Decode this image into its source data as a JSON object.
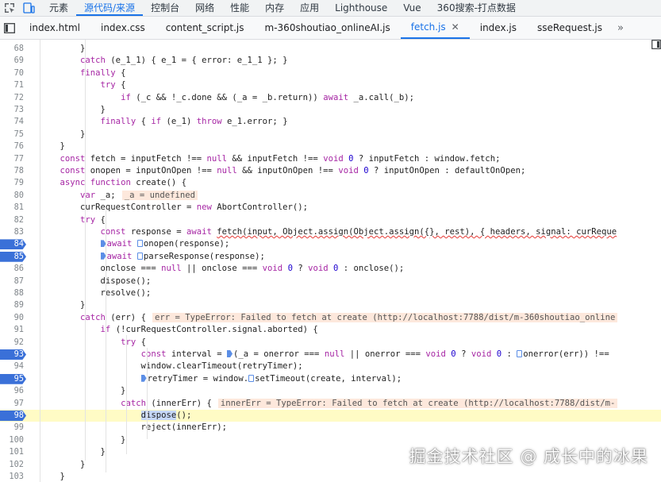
{
  "panel_tabs": [
    "元素",
    "源代码/来源",
    "控制台",
    "网络",
    "性能",
    "内存",
    "应用",
    "Lighthouse",
    "Vue",
    "360搜索-打点数据"
  ],
  "active_panel": 1,
  "file_tabs": [
    "index.html",
    "index.css",
    "content_script.js",
    "m-360shoutiao_onlineAI.js",
    "fetch.js",
    "index.js",
    "sseRequest.js"
  ],
  "active_file": 4,
  "more_tabs": "»",
  "lines": [
    {
      "n": "68",
      "code": "        }"
    },
    {
      "n": "69",
      "code": "        catch (e_1_1) { e_1 = { error: e_1_1 }; }"
    },
    {
      "n": "70",
      "code": "        finally {"
    },
    {
      "n": "71",
      "code": "            try {"
    },
    {
      "n": "72",
      "code": "                if (_c && !_c.done && (_a = _b.return)) await _a.call(_b);"
    },
    {
      "n": "73",
      "code": "            }"
    },
    {
      "n": "74",
      "code": "            finally { if (e_1) throw e_1.error; }"
    },
    {
      "n": "75",
      "code": "        }"
    },
    {
      "n": "76",
      "code": "    }"
    },
    {
      "n": "77",
      "code": "    const fetch = inputFetch !== null && inputFetch !== void 0 ? inputFetch : window.fetch;"
    },
    {
      "n": "78",
      "code": "    const onopen = inputOnOpen !== null && inputOnOpen !== void 0 ? inputOnOpen : defaultOnOpen;"
    },
    {
      "n": "79",
      "code": "    async function create() {"
    },
    {
      "n": "80",
      "code": "        var _a;",
      "inline": "_a = undefined"
    },
    {
      "n": "81",
      "code": "        curRequestController = new AbortController();"
    },
    {
      "n": "82",
      "code": "        try {"
    },
    {
      "n": "83",
      "code": "            const response = await fetch(input, Object.assign(Object.assign({}, rest), { headers, signal: curReque"
    },
    {
      "n": "84",
      "code": "            await onopen(response);",
      "bp": true
    },
    {
      "n": "85",
      "code": "            await parseResponse(response);",
      "bp": true
    },
    {
      "n": "86",
      "code": "            onclose === null || onclose === void 0 ? void 0 : onclose();"
    },
    {
      "n": "87",
      "code": "            dispose();"
    },
    {
      "n": "88",
      "code": "            resolve();"
    },
    {
      "n": "89",
      "code": "        }"
    },
    {
      "n": "90",
      "code": "        catch (err) {",
      "inline": "err = TypeError: Failed to fetch at create (http://localhost:7788/dist/m-360shoutiao_online"
    },
    {
      "n": "91",
      "code": "            if (!curRequestController.signal.aborted) {"
    },
    {
      "n": "92",
      "code": "                try {"
    },
    {
      "n": "93",
      "code": "                    const interval = (_a = onerror === null || onerror === void 0 ? void 0 : onerror(err)) !==",
      "bp": true
    },
    {
      "n": "94",
      "code": "                    window.clearTimeout(retryTimer);"
    },
    {
      "n": "95",
      "code": "                    retryTimer = window.setTimeout(create, interval);",
      "bp": true
    },
    {
      "n": "96",
      "code": "                }"
    },
    {
      "n": "97",
      "code": "                catch (innerErr) {",
      "inline": "innerErr = TypeError: Failed to fetch at create (http://localhost:7788/dist/m-"
    },
    {
      "n": "98",
      "code": "                    dispose();",
      "bp": true,
      "exec": true
    },
    {
      "n": "99",
      "code": "                    reject(innerErr);"
    },
    {
      "n": "100",
      "code": "                }"
    },
    {
      "n": "101",
      "code": "            }"
    },
    {
      "n": "102",
      "code": "        }"
    },
    {
      "n": "103",
      "code": "    }"
    }
  ],
  "watermark": "掘金技术社区 @ 成长中的冰果",
  "colors": {
    "accent": "#1a73e8",
    "breakpoint": "#3a70d8",
    "exec_line": "#fffbc5",
    "inline_value_bg": "#fde8dc",
    "keyword": "#a626a4"
  }
}
